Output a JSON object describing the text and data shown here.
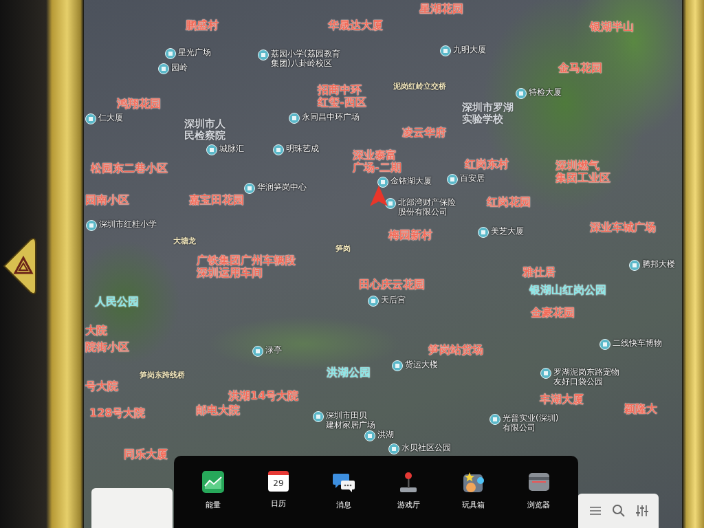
{
  "map": {
    "labels": [
      {
        "kind": "place",
        "text": "鹏盛村"
      },
      {
        "kind": "place",
        "text": "华晟达大厦"
      },
      {
        "kind": "place",
        "text": "星湖花园"
      },
      {
        "kind": "place",
        "text": "银湖半山"
      },
      {
        "kind": "poi",
        "text": "星光广场"
      },
      {
        "kind": "poi",
        "text": "园岭"
      },
      {
        "kind": "poi",
        "text": "荔园小学(荔园教育集团)八卦岭校区"
      },
      {
        "kind": "poi",
        "text": "九明大厦"
      },
      {
        "kind": "place",
        "text": "金马花园"
      },
      {
        "kind": "road",
        "text": "泥岗红岭立交桥"
      },
      {
        "kind": "poi",
        "text": "特检大厦"
      },
      {
        "kind": "place",
        "text": "鸿翔花园"
      },
      {
        "kind": "place",
        "text": "招商中环红玺-西区"
      },
      {
        "kind": "poi",
        "text": "仁大厦"
      },
      {
        "kind": "school",
        "text": "深圳市罗湖实验学校"
      },
      {
        "kind": "school",
        "text": "深圳市人民检察院"
      },
      {
        "kind": "poi",
        "text": "永同昌中环广场"
      },
      {
        "kind": "place",
        "text": "凌云华府"
      },
      {
        "kind": "poi",
        "text": "城脉汇"
      },
      {
        "kind": "poi",
        "text": "明珠艺成"
      },
      {
        "kind": "place",
        "text": "松园东二巷小区"
      },
      {
        "kind": "place",
        "text": "深业泰富广场-二期"
      },
      {
        "kind": "place",
        "text": "红岗东村"
      },
      {
        "kind": "place",
        "text": "深圳燃气集团工业区"
      },
      {
        "kind": "poi",
        "text": "华润笋岗中心"
      },
      {
        "kind": "poi",
        "text": "金铱湖大厦"
      },
      {
        "kind": "poi",
        "text": "百安居"
      },
      {
        "kind": "poi",
        "text": "北部湾财产保险股份有限公司"
      },
      {
        "kind": "place",
        "text": "园南小区"
      },
      {
        "kind": "place",
        "text": "嘉宝田花园"
      },
      {
        "kind": "place",
        "text": "红岗花园"
      },
      {
        "kind": "poi",
        "text": "深圳市红桂小学"
      },
      {
        "kind": "road",
        "text": "大塘龙"
      },
      {
        "kind": "road",
        "text": "笋岗"
      },
      {
        "kind": "place",
        "text": "梅园新村"
      },
      {
        "kind": "poi",
        "text": "美芝大厦"
      },
      {
        "kind": "place",
        "text": "深业车城广场"
      },
      {
        "kind": "place",
        "text": "广铁集团广州车辆段深圳运用车间"
      },
      {
        "kind": "poi",
        "text": "腾邦大楼"
      },
      {
        "kind": "place",
        "text": "雅仕居"
      },
      {
        "kind": "place",
        "text": "田心庆云花园"
      },
      {
        "kind": "park",
        "text": "银湖山红岗公园"
      },
      {
        "kind": "park",
        "text": "人民公园"
      },
      {
        "kind": "poi",
        "text": "天后宫"
      },
      {
        "kind": "place",
        "text": "金豪花园"
      },
      {
        "kind": "place",
        "text": "大院"
      },
      {
        "kind": "place",
        "text": "院街小区"
      },
      {
        "kind": "poi",
        "text": "二线快车博物"
      },
      {
        "kind": "poi",
        "text": "渌亭"
      },
      {
        "kind": "place",
        "text": "笋岗站货场"
      },
      {
        "kind": "park",
        "text": "洪湖公园"
      },
      {
        "kind": "poi",
        "text": "货运大楼"
      },
      {
        "kind": "road",
        "text": "笋岗东跨线桥"
      },
      {
        "kind": "poi",
        "text": "罗湖泥岗东路宠物友好口袋公园"
      },
      {
        "kind": "place",
        "text": "号大院"
      },
      {
        "kind": "place",
        "text": "洪湖14号大院"
      },
      {
        "kind": "place",
        "text": "丰湖大厦"
      },
      {
        "kind": "place",
        "text": "128号大院"
      },
      {
        "kind": "place",
        "text": "邮电大院"
      },
      {
        "kind": "place",
        "text": "颖隆大"
      },
      {
        "kind": "poi",
        "text": "深圳市田贝建材家居广场"
      },
      {
        "kind": "poi",
        "text": "光普实业(深圳)有限公司"
      },
      {
        "kind": "poi",
        "text": "洪湖"
      },
      {
        "kind": "poi",
        "text": "水贝社区公园"
      },
      {
        "kind": "place",
        "text": "同乐大厦"
      }
    ]
  },
  "dock": {
    "apps": [
      {
        "kind": "energy",
        "label": "能量"
      },
      {
        "kind": "calendar",
        "label": "日历",
        "day": "29"
      },
      {
        "kind": "messages",
        "label": "消息"
      },
      {
        "kind": "games",
        "label": "游戏厅"
      },
      {
        "kind": "toybox",
        "label": "玩具箱"
      },
      {
        "kind": "browser",
        "label": "浏览器"
      }
    ]
  }
}
